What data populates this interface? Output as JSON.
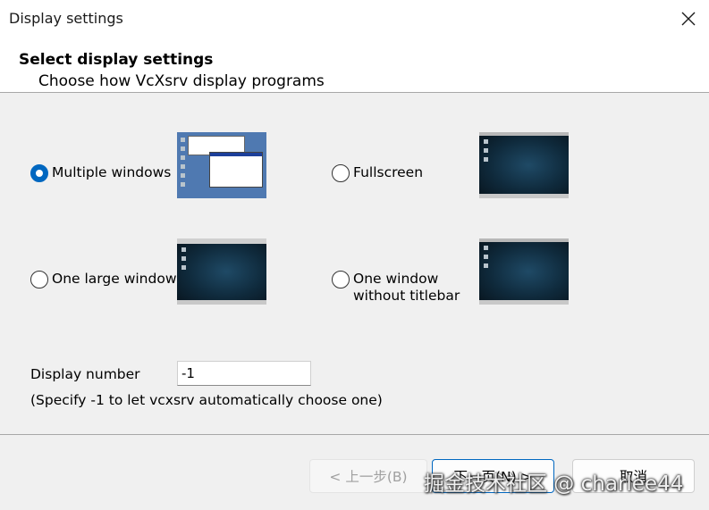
{
  "window": {
    "title": "Display settings"
  },
  "header": {
    "title": "Select display settings",
    "subtitle": "Choose how VcXsrv display programs"
  },
  "options": [
    {
      "id": "multiple-windows",
      "label": "Multiple windows",
      "checked": true,
      "thumbnail": "desktop-with-windows"
    },
    {
      "id": "fullscreen",
      "label": "Fullscreen",
      "checked": false,
      "thumbnail": "dark-desktop"
    },
    {
      "id": "one-large-window",
      "label": "One large window",
      "checked": false,
      "thumbnail": "dark-desktop-in-window"
    },
    {
      "id": "one-window-without-titlebar",
      "label": "One window\nwithout titlebar",
      "checked": false,
      "thumbnail": "dark-desktop-no-titlebar"
    }
  ],
  "display_number": {
    "label": "Display number",
    "value": "-1",
    "hint": "(Specify -1 to let vcxsrv automatically choose one)"
  },
  "buttons": {
    "back": "< 上一步(B)",
    "next": "下一页(N) >",
    "cancel": "取消"
  },
  "watermark": "掘金技术社区 @ charlee44",
  "colors": {
    "accent": "#0067c0",
    "background": "#f0f0f0"
  }
}
